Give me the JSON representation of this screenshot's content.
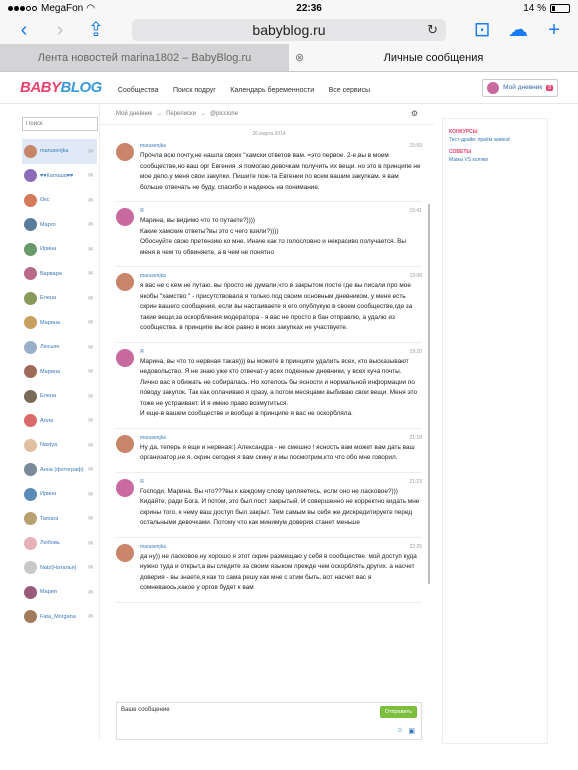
{
  "status_bar": {
    "carrier": "MegaFon",
    "time": "22:36",
    "battery": "14 %"
  },
  "browser": {
    "url": "babyblog.ru",
    "tabs": [
      {
        "label": "Лента новостей marina1802 – BabyBlog.ru"
      },
      {
        "label": "Личные сообщения"
      }
    ]
  },
  "site": {
    "logo_baby": "BABY",
    "logo_blog": "BLOG",
    "nav": [
      "Сообщества",
      "Поиск подруг",
      "Календарь беременности",
      "Все сервисы"
    ],
    "my_diary": "Мой дневник",
    "my_diary_badge": "8"
  },
  "sidebar": {
    "search_placeholder": "Поиск",
    "contacts": [
      {
        "name": "marusenjka",
        "color": "#c9856a",
        "selected": true
      },
      {
        "name": "♥♥Катюша♥♥",
        "color": "#8c6bb8"
      },
      {
        "name": "Окс",
        "color": "#d47a5a"
      },
      {
        "name": "Марго",
        "color": "#5a7c9c"
      },
      {
        "name": "Ирина",
        "color": "#6a9a6a"
      },
      {
        "name": "Варвара",
        "color": "#b86a8a"
      },
      {
        "name": "Елена",
        "color": "#8a9a5a"
      },
      {
        "name": "Марина",
        "color": "#c8a060"
      },
      {
        "name": "Люсьен",
        "color": "#9ab0c8"
      },
      {
        "name": "Марина",
        "color": "#a06a5a"
      },
      {
        "name": "Елена",
        "color": "#7a6a5a"
      },
      {
        "name": "Алла",
        "color": "#d86a6a"
      },
      {
        "name": "Nastya",
        "color": "#e0c0a0"
      },
      {
        "name": "Анна (фотограф)",
        "color": "#7a8a9a"
      },
      {
        "name": "Ирина",
        "color": "#5a8ab8"
      },
      {
        "name": "Tamara",
        "color": "#b8a070"
      },
      {
        "name": "Любовь",
        "color": "#e8b0b8"
      },
      {
        "name": "Natz(Наталья)",
        "color": "#c8c8c8"
      },
      {
        "name": "Мария",
        "color": "#9a5a7a"
      },
      {
        "name": "Fata_Morgana",
        "color": "#a07a5a"
      }
    ]
  },
  "main": {
    "breadcrumbs": [
      "Мой дневник",
      "→",
      "Переписки",
      "→",
      "@piccione"
    ],
    "date": "26 марта 2014",
    "messages": [
      {
        "author": "marusenjka",
        "time": "15:59",
        "color": "#c9856a",
        "text": "Прочла всю почту,не нашла своих \"хамски ответов вам. =это первое. 2-е,вы в моем сообществе,но ваш орг Евгения .я помогаю девочкам получить их вещи. но это в принципе не мое дело.у меня свои закупки. Пишите пож-та Евгении по всем вашим закупкам. я вам больше отвечать не буду, спасибо и надеюсь на понимание."
      },
      {
        "author": "Я",
        "time": "15:41",
        "color": "#c86aa0",
        "text": "Марина, вы видимо что то путаете?))))\nКакие хамские ответы?вы это с чего взяли?))))\nОбоснуйте свою претензию ко мне. Иначе как то голословно и некрасиво получается. Вы меня в чем то обвиняете, а в чем не понятно"
      },
      {
        "author": "marusenjka",
        "time": "19:08",
        "color": "#c9856a",
        "text": "я вас не с кем не путаю. вы просто не думали,что в закрытом посте где вы писали про мое якобы \"хамство \" - присутствовала я только под своим основным дневником. у меня есть скрин вашего сообщения. если вы настаиваете я его опублукую в своем сообществе,где за такие вещи,за оскорбления модератора - я вас не просто в бан отправлю, а удалю из сообщества. в принципе вы все равно в моих закупках не участвуете."
      },
      {
        "author": "Я",
        "time": "19:20",
        "color": "#c86aa0",
        "text": "Марина, вы что то нервная такая))) вы можете в принципе удалить всех, кто высказывают недовольство. Я не знаю уже кто отвечат-у всех поденные дневники, у всех куча почты.\nЛично вас я обижать не собиралась. Но хотелось бы ясности и нормальной информации по поводу закупок. Так как оплачиваю я сразу, а потом месяцами выбиваю свои вещи. Меня это тоже не устраивает. И я имею право возмутиться.\nИ еще-в вашем сообществе и вообще в принципе я вас не оскорбляла."
      },
      {
        "author": "marusenjka",
        "time": "21:18",
        "color": "#c9856a",
        "text": "Ну да, теперь я еще и нервная:) Александра - не смешно ! ясность вам может вам дать ваш организатор,не я. скрин сегодня я вам скину и мы посмотрим,кто что обо мне говорил."
      },
      {
        "author": "Я",
        "time": "21:23",
        "color": "#c86aa0",
        "text": "Господи, Марина. Вы что???вы к каждому слову цепляетесь, если оно не ласковое?)))\nКидайте, ради Бога. И потом, это был пост закрытый. И совершенно не корректно кидать мне скрины того, к чему ваш доступ был закрыт. Тем самым вы себя же дискредитируете перед остальными девочками. Потому что как минимум доверия станет меньше"
      },
      {
        "author": "marusenjka",
        "time": "22:25",
        "color": "#c9856a",
        "text": "да ну)) не ласковое.ну хорошо я этот скрин размещаю у себя в сообществе. мой доступ куда нужно туда и открыт,а вы следите за своим языком прежде чем оскорблять других. а насчет доверия - вы знаете,я как то сама решу как мне с этим быть. вот насчет вас я сомневаюсь,какое у оргов будет к вам"
      }
    ],
    "compose_placeholder": "Ваше сообщение",
    "send_label": "Отправить"
  },
  "right": {
    "sections": [
      {
        "title": "КОНКУРСЫ",
        "link": "Тест-драйв: приём заявок!"
      },
      {
        "title": "СОВЕТЫ",
        "link": "Мамы VS коляки"
      }
    ]
  }
}
